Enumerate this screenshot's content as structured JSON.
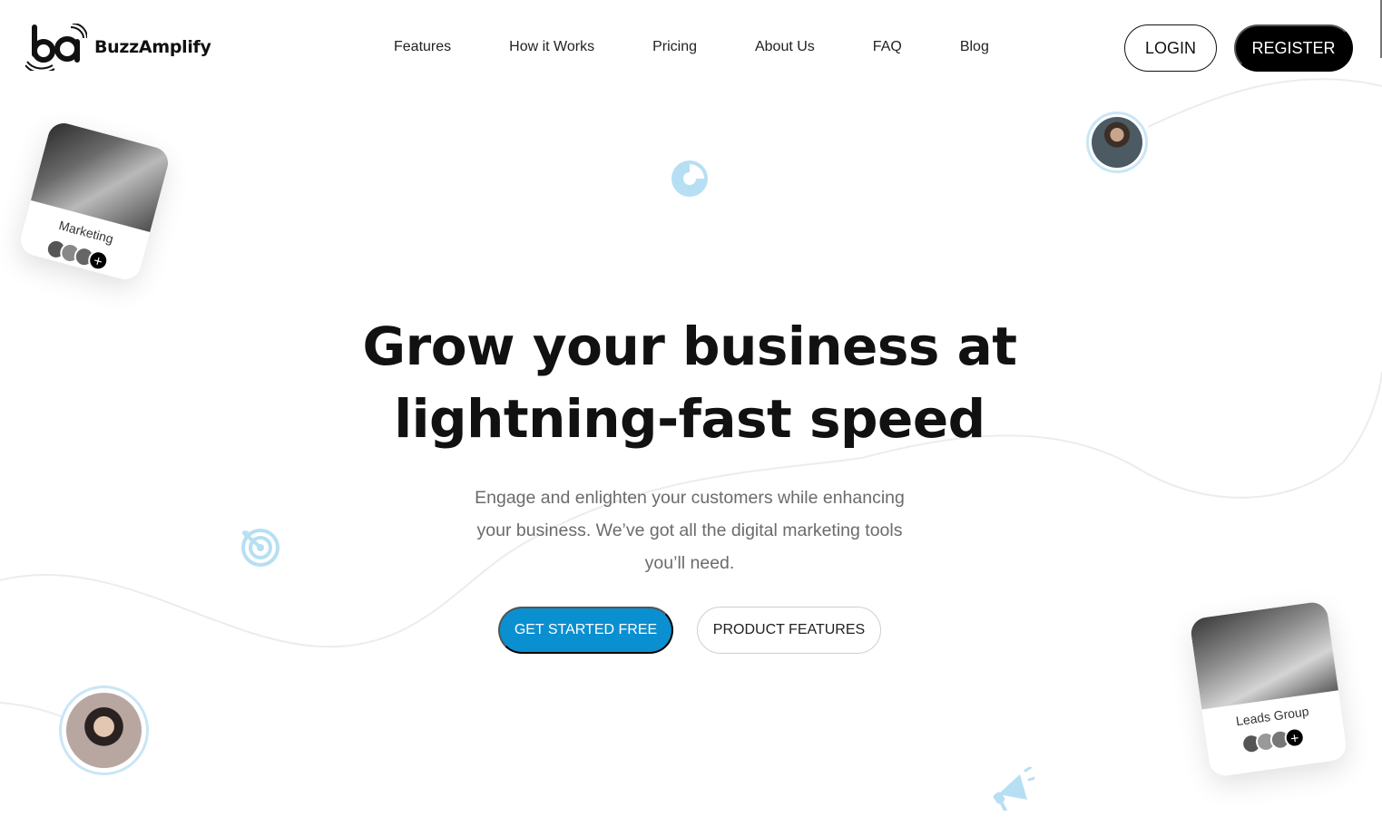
{
  "brand": {
    "name": "BuzzAmplify"
  },
  "nav": {
    "links": [
      "Features",
      "How it Works",
      "Pricing",
      "About Us",
      "FAQ",
      "Blog"
    ],
    "login_label": "LOGIN",
    "register_label": "REGISTER"
  },
  "hero": {
    "title_line1": "Grow your business at",
    "title_line2": "lightning-fast speed",
    "subtitle": "Engage and enlighten your customers while enhancing your business. We’ve got all the digital marketing tools you’ll need.",
    "primary_cta": "GET STARTED FREE",
    "secondary_cta": "PRODUCT FEATURES"
  },
  "cards": {
    "marketing": {
      "label": "Marketing",
      "plus": "+"
    },
    "leads": {
      "label": "Leads Group",
      "plus": "+"
    }
  },
  "colors": {
    "accent": "#0a8fd0",
    "icon_tint": "#b7dff3",
    "dark": "#000000"
  },
  "icons": [
    "pie-chart-icon",
    "target-icon",
    "megaphone-icon"
  ]
}
